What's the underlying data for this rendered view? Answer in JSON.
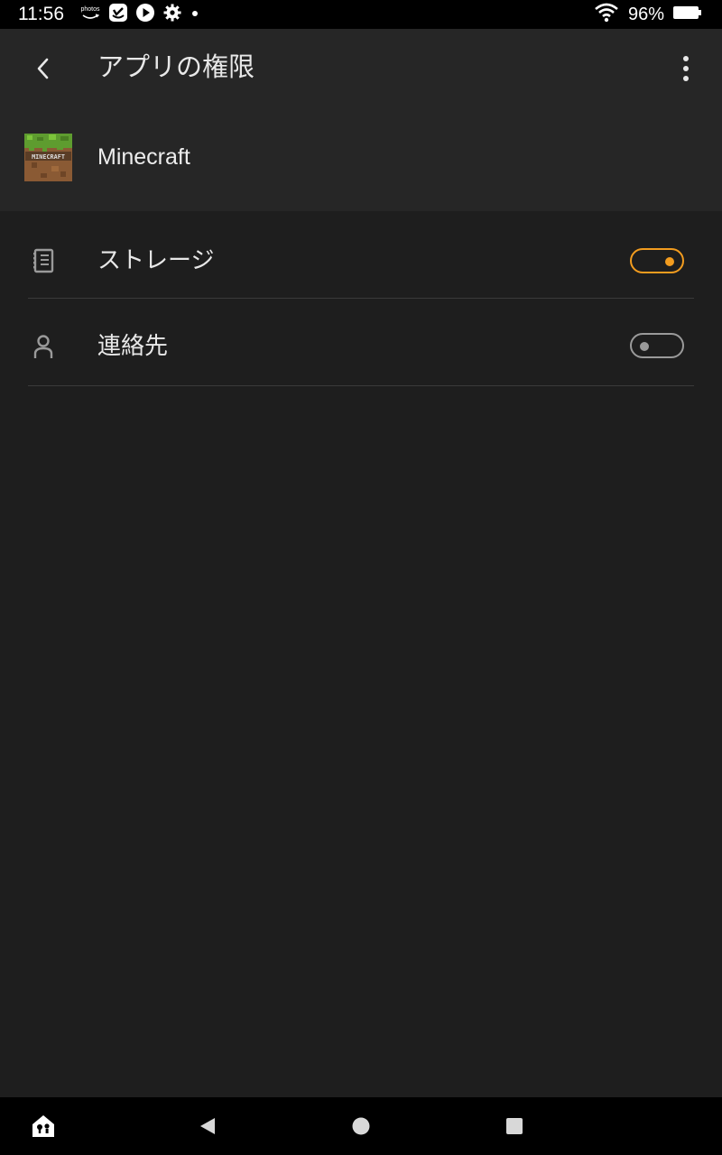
{
  "status_bar": {
    "time": "11:56",
    "photos_label": "photos",
    "battery_percent": "96%",
    "icons": [
      "photos-icon",
      "shield-check-icon",
      "play-icon",
      "gear-icon",
      "dot-icon",
      "wifi-icon",
      "battery-icon"
    ]
  },
  "header": {
    "title": "アプリの権限",
    "back_icon": "back-chevron-icon",
    "overflow_icon": "more-vert-icon"
  },
  "app": {
    "name": "Minecraft",
    "icon": "minecraft-app-icon",
    "icon_text": "MINECRAFT"
  },
  "permissions": [
    {
      "label": "ストレージ",
      "icon": "storage-icon",
      "enabled": true
    },
    {
      "label": "連絡先",
      "icon": "contacts-person-icon",
      "enabled": false
    }
  ],
  "nav_bar": {
    "icons": [
      "kids-lock-icon",
      "back-triangle-icon",
      "home-circle-icon",
      "recents-square-icon"
    ]
  },
  "colors": {
    "background": "#1e1e1e",
    "app_bar": "#262626",
    "accent": "#f29c1f",
    "toggle_off": "#9a9a9a",
    "divider": "#3a3a3a"
  }
}
